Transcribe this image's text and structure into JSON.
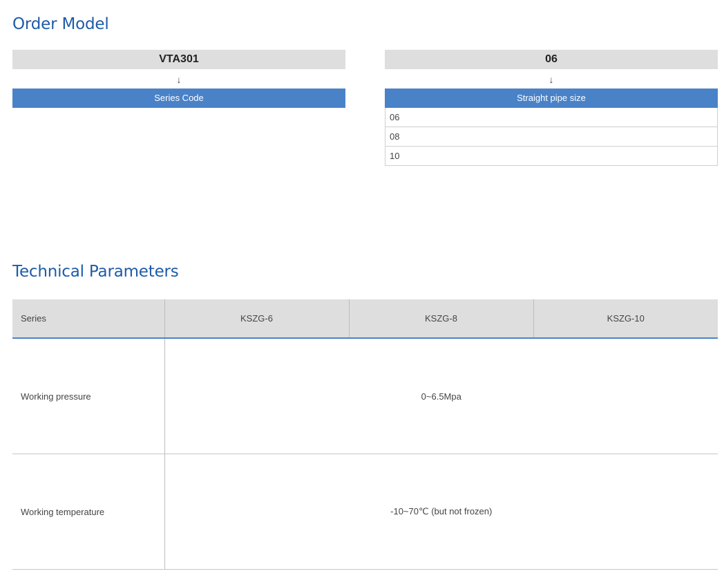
{
  "order_model": {
    "title": "Order Model",
    "series": {
      "code": "VTA301",
      "arrow": "↓",
      "label": "Series Code"
    },
    "size": {
      "code": "06",
      "arrow": "↓",
      "label": "Straight pipe size",
      "options": [
        "06",
        "08",
        "10"
      ]
    }
  },
  "technical_parameters": {
    "title": "Technical Parameters",
    "columns": [
      "Series",
      "KSZG-6",
      "KSZG-8",
      "KSZG-10"
    ],
    "rows": [
      {
        "label": "Working pressure",
        "value": "0~6.5Mpa"
      },
      {
        "label": "Working temperature",
        "value": "-10~70℃ (but not frozen)"
      }
    ]
  }
}
